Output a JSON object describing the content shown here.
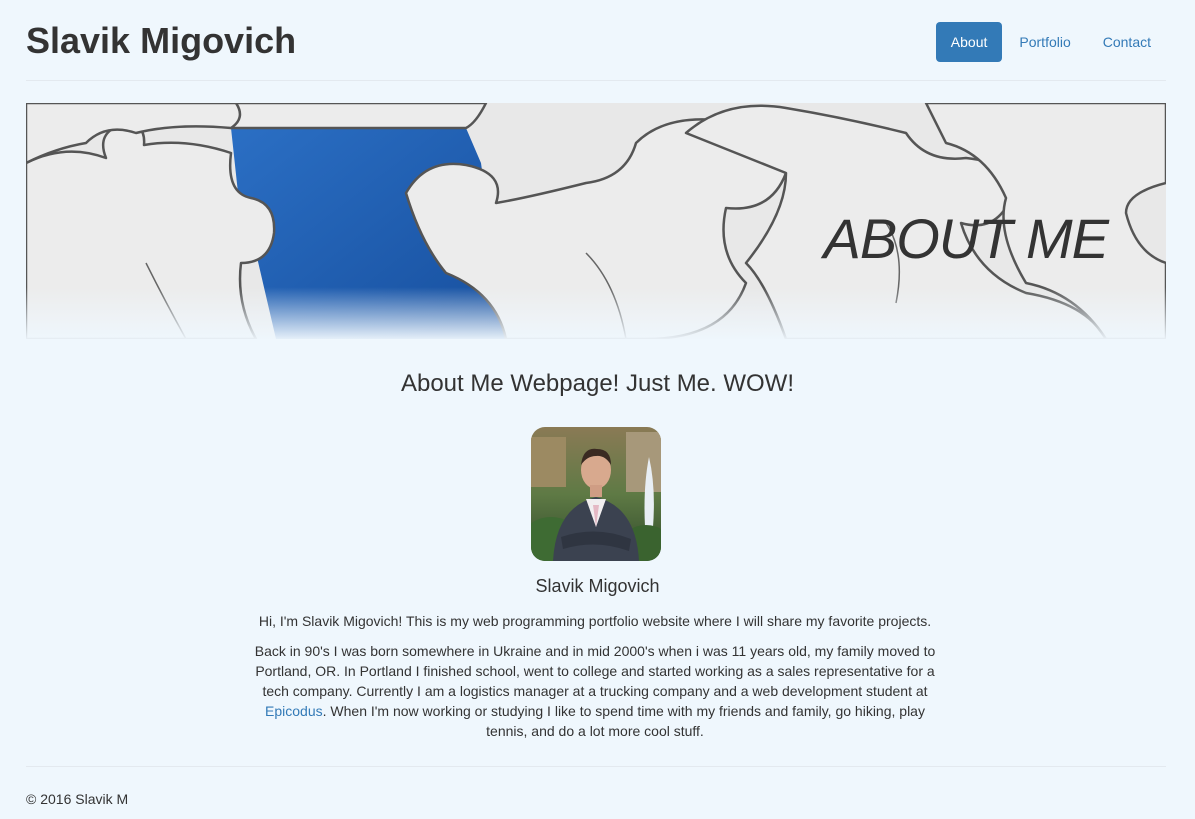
{
  "site": {
    "title": "Slavik Migovich"
  },
  "nav": {
    "about_label": "About",
    "portfolio_label": "Portfolio",
    "contact_label": "Contact",
    "active": "About"
  },
  "hero": {
    "title": "ABOUT ME",
    "image": "puzzle-pieces-banner"
  },
  "main": {
    "heading": "About Me Webpage! Just Me. WOW!",
    "avatar_image": "profile-photo",
    "name": "Slavik Migovich",
    "intro": "Hi, I'm Slavik Migovich! This is my web programming portfolio website where I will share my favorite projects.",
    "bio_part1": "Back in 90's I was born somewhere in Ukraine and in mid 2000's when i was 11 years old, my family moved to Portland, OR. In Portland I finished school, went to college and started working as a sales representative for a tech company. Currently I am a logistics manager at a trucking company and a web development student at ",
    "bio_link": "Epicodus",
    "bio_part2": ". When I'm now working or studying I like to spend time with my friends and family, go hiking, play tennis, and do a lot more cool stuff."
  },
  "footer": {
    "text": "© 2016 Slavik M"
  },
  "colors": {
    "background": "#eff7fd",
    "accent": "#337ab7",
    "text": "#333333",
    "puzzle_blue": "#1f5fb4"
  }
}
